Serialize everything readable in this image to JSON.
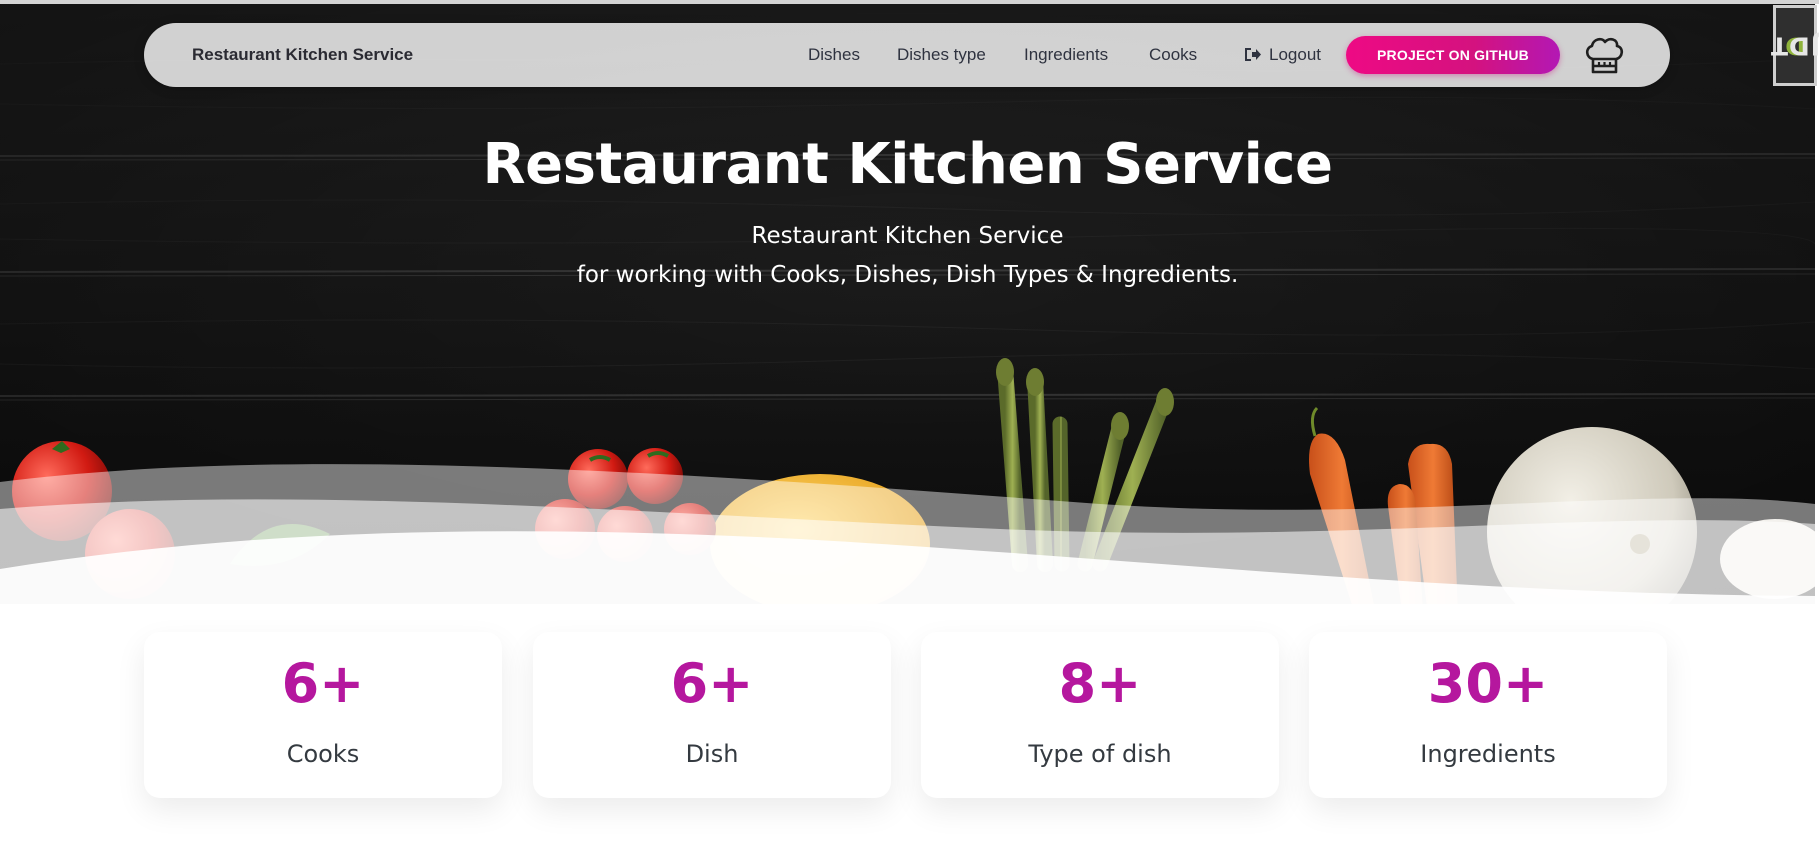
{
  "navbar": {
    "brand": "Restaurant Kitchen Service",
    "links": [
      "Dishes",
      "Dishes type",
      "Ingredients",
      "Cooks"
    ],
    "logout_label": "Logout",
    "github_button": "PROJECT ON GITHUB",
    "chef_icon": "chef-hat-icon",
    "logout_icon": "sign-out-icon"
  },
  "debug_toolbar": {
    "label": "DJDT"
  },
  "hero": {
    "title": "Restaurant Kitchen Service",
    "subtitle_line1": "Restaurant Kitchen Service",
    "subtitle_line2": "for working with Cooks, Dishes, Dish Types & Ingredients."
  },
  "stats": [
    {
      "value": "6+",
      "label": "Cooks"
    },
    {
      "value": "6+",
      "label": "Dish"
    },
    {
      "value": "8+",
      "label": "Type of dish"
    },
    {
      "value": "30+",
      "label": "Ingredients"
    }
  ],
  "colors": {
    "accent": "#b5179e",
    "button_gradient_start": "#ee0a84",
    "button_gradient_end": "#b318b4"
  }
}
